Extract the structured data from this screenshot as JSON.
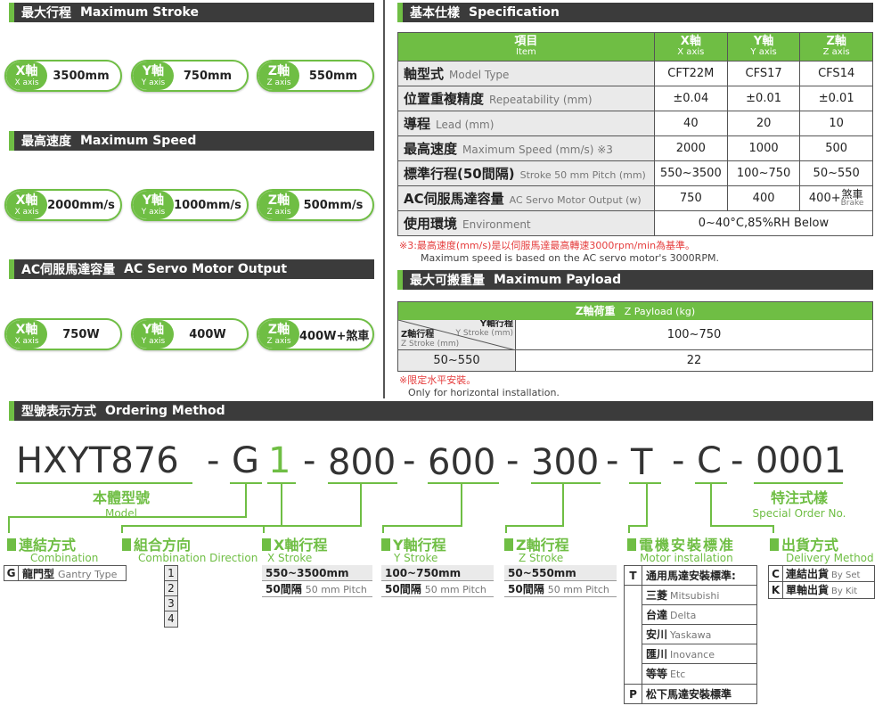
{
  "sections": {
    "stroke": {
      "zh": "最大行程",
      "en": "Maximum Stroke"
    },
    "speed": {
      "zh": "最高速度",
      "en": "Maximum Speed"
    },
    "motor": {
      "zh": "AC伺服馬達容量",
      "en": "AC Servo Motor Output"
    },
    "spec": {
      "zh": "基本仕樣",
      "en": "Specification"
    },
    "payload": {
      "zh": "最大可搬重量",
      "en": "Maximum Payload"
    },
    "ordering": {
      "zh": "型號表示方式",
      "en": "Ordering Method"
    }
  },
  "axes": {
    "x": {
      "zh": "X軸",
      "en": "X axis"
    },
    "y": {
      "zh": "Y軸",
      "en": "Y axis"
    },
    "z": {
      "zh": "Z軸",
      "en": "Z axis"
    }
  },
  "pills": {
    "stroke": [
      "3500mm",
      "750mm",
      "550mm"
    ],
    "speed": [
      "2000mm/s",
      "1000mm/s",
      "500mm/s"
    ],
    "motor": [
      "750W",
      "400W",
      "400W+煞車"
    ]
  },
  "spec_table": {
    "header": {
      "item_zh": "項目",
      "item_en": "Item"
    },
    "rows": [
      {
        "zh": "軸型式",
        "en": "Model Type",
        "x": "CFT22M",
        "y": "CFS17",
        "z": "CFS14"
      },
      {
        "zh": "位置重複精度",
        "en": "Repeatability (mm)",
        "x": "±0.04",
        "y": "±0.01",
        "z": "±0.01"
      },
      {
        "zh": "導程",
        "en": "Lead (mm)",
        "x": "40",
        "y": "20",
        "z": "10"
      },
      {
        "zh": "最高速度",
        "en": "Maximum Speed (mm/s) ※3",
        "x": "2000",
        "y": "1000",
        "z": "500"
      },
      {
        "zh": "標準行程(50間隔)",
        "en": "Stroke 50 mm Pitch (mm)",
        "x": "550~3500",
        "y": "100~750",
        "z": "50~550"
      },
      {
        "zh": "AC伺服馬達容量",
        "en": "AC Servo Motor Output (w)",
        "x": "750",
        "y": "400",
        "z": "400+",
        "z_brake_zh": "煞車",
        "z_brake_en": "Brake"
      }
    ],
    "env": {
      "zh": "使用環境",
      "en": "Environment",
      "value": "0~40°C,85%RH Below"
    }
  },
  "spec_note": {
    "zh": "※3:最高速度(mm/s)是以伺服馬達最高轉速3000rpm/min為基準。",
    "en": "Maximum speed is based on the AC servo motor's 3000RPM."
  },
  "payload_table": {
    "header": {
      "zh": "Z軸荷重",
      "en": "Z Payload (kg)"
    },
    "diag_y_zh": "Y軸行程",
    "diag_y_en": "Y Stroke (mm)",
    "diag_z_zh": "Z軸行程",
    "diag_z_en": "Z Stroke (mm)",
    "y_range": "100~750",
    "z_range": "50~550",
    "value": "22"
  },
  "payload_note": {
    "zh": "※限定水平安裝。",
    "en": "Only for horizontal installation."
  },
  "ordering": {
    "parts": [
      "HXYT876",
      "-",
      "G",
      "1",
      "-",
      "800",
      "-",
      "600",
      "-",
      "300",
      "-",
      "T",
      "-",
      "C",
      "-",
      "0001"
    ],
    "model": {
      "zh": "本體型號",
      "en": "Model"
    },
    "special": {
      "zh": "特注式樣",
      "en": "Special Order No."
    },
    "combination": {
      "zh": "連結方式",
      "en": "Combination",
      "code": "G",
      "opt_zh": "龍門型",
      "opt_en": "Gantry Type"
    },
    "direction": {
      "zh": "組合方向",
      "en": "Combination Direction",
      "codes": [
        "1",
        "2",
        "3",
        "4"
      ]
    },
    "x_stroke": {
      "zh": "X軸行程",
      "en": "X Stroke",
      "range": "550~3500mm",
      "pitch_zh": "50間隔",
      "pitch_en": "50 mm Pitch"
    },
    "y_stroke": {
      "zh": "Y軸行程",
      "en": "Y Stroke",
      "range": "100~750mm",
      "pitch_zh": "50間隔",
      "pitch_en": "50 mm Pitch"
    },
    "z_stroke": {
      "zh": "Z軸行程",
      "en": "Z Stroke",
      "range": "50~550mm",
      "pitch_zh": "50間隔",
      "pitch_en": "50 mm Pitch"
    },
    "motor_install": {
      "zh": "電機安裝標准",
      "en": "Motor installation",
      "t_code": "T",
      "t_label": "通用馬達安裝標準:",
      "brands": [
        {
          "zh": "三菱",
          "en": "Mitsubishi"
        },
        {
          "zh": "台達",
          "en": "Delta"
        },
        {
          "zh": "安川",
          "en": "Yaskawa"
        },
        {
          "zh": "匯川",
          "en": "Inovance"
        },
        {
          "zh": "等等",
          "en": "Etc"
        }
      ],
      "p_code": "P",
      "p_label": "松下馬達安裝標準"
    },
    "delivery": {
      "zh": "出貨方式",
      "en": "Delivery Method",
      "options": [
        {
          "code": "C",
          "zh": "連結出貨",
          "en": "By Set"
        },
        {
          "code": "K",
          "zh": "單軸出貨",
          "en": "By Kit"
        }
      ]
    }
  },
  "colors": {
    "accent": "#6fbe44",
    "header_bg": "#3b3b3b"
  }
}
